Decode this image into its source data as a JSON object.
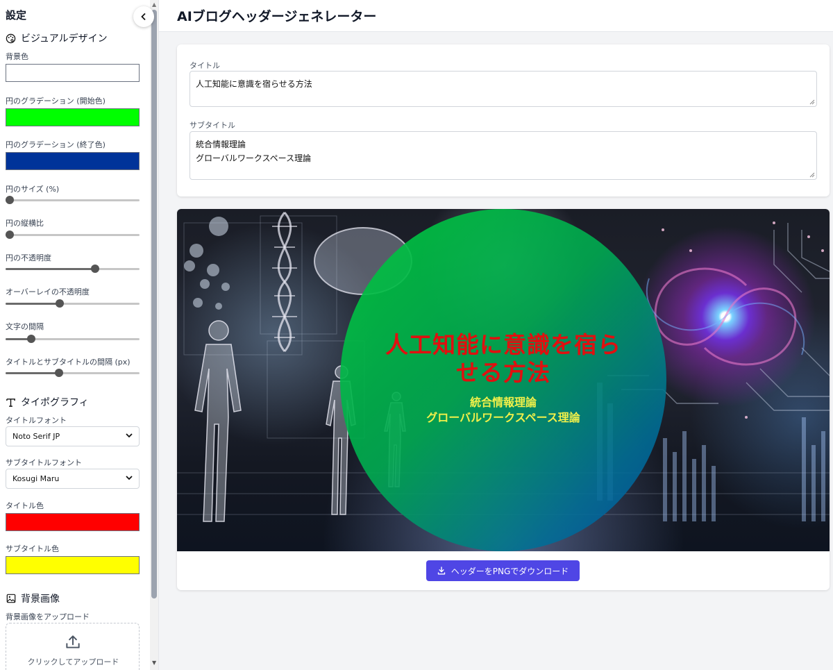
{
  "sidebar": {
    "title": "設定",
    "collapse_icon": "chevron-left-icon",
    "visual_design": {
      "heading": "ビジュアルデザイン",
      "icon": "palette-icon",
      "bg_color": {
        "label": "背景色",
        "value": "#ffffff"
      },
      "grad_start": {
        "label": "円のグラデーション (開始色)",
        "value": "#00ff00"
      },
      "grad_end": {
        "label": "円のグラデーション (終了色)",
        "value": "#003399"
      },
      "circle_size": {
        "label": "円のサイズ (%)",
        "value_fraction": 0.0
      },
      "aspect": {
        "label": "円の縦横比",
        "value_fraction": 0.0
      },
      "circle_opacity": {
        "label": "円の不透明度",
        "value_fraction": 0.68
      },
      "overlay_opacity": {
        "label": "オーバーレイの不透明度",
        "value_fraction": 0.4
      },
      "letter_spacing": {
        "label": "文字の間隔",
        "value_fraction": 0.17
      },
      "title_sub_gap": {
        "label": "タイトルとサブタイトルの間隔 (px)",
        "value_fraction": 0.39
      }
    },
    "typography": {
      "heading": "タイポグラフィ",
      "icon": "text-t-icon",
      "title_font": {
        "label": "タイトルフォント",
        "value": "Noto Serif JP"
      },
      "subtitle_font": {
        "label": "サブタイトルフォント",
        "value": "Kosugi Maru"
      },
      "title_color": {
        "label": "タイトル色",
        "value": "#ff0000"
      },
      "subtitle_color": {
        "label": "サブタイトル色",
        "value": "#ffff00"
      }
    },
    "bg_image": {
      "heading": "背景画像",
      "icon": "image-icon",
      "upload_label": "背景画像をアップロード",
      "upload_text": "クリックしてアップロード",
      "upload_icon": "upload-icon"
    }
  },
  "header": {
    "title": "AIブログヘッダージェネレーター"
  },
  "form": {
    "title_label": "タイトル",
    "title_value": "人工知能に意識を宿らせる方法",
    "subtitle_label": "サブタイトル",
    "subtitle_lines": [
      "統合情報理論",
      "グローバルワークスペース理論"
    ]
  },
  "preview": {
    "title_lines": [
      "人工知能に意識を宿ら",
      "せる方法"
    ],
    "subtitle_lines": [
      "統合情報理論",
      "グローバルワークスペース理論"
    ]
  },
  "download": {
    "label": "ヘッダーをPNGでダウンロード",
    "icon": "download-icon"
  }
}
